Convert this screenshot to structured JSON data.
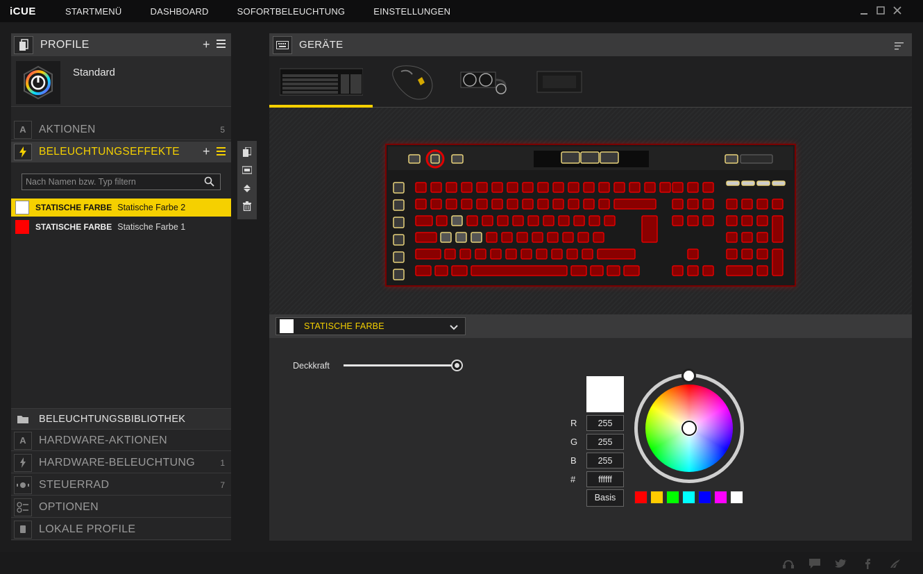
{
  "app": {
    "logo": "iCUE"
  },
  "nav": {
    "items": [
      {
        "label": "STARTMENÜ"
      },
      {
        "label": "DASHBOARD"
      },
      {
        "label": "SOFORTBELEUCHTUNG"
      },
      {
        "label": "EINSTELLUNGEN"
      }
    ]
  },
  "profiles": {
    "title": "PROFILE",
    "current": "Standard"
  },
  "sections": {
    "aktionen": {
      "label": "AKTIONEN",
      "count": "5"
    },
    "effects": {
      "label": "BELEUCHTUNGSEFFEKTE"
    },
    "library": {
      "label": "BELEUCHTUNGSBIBLIOTHEK"
    },
    "hw_actions": {
      "label": "HARDWARE-AKTIONEN"
    },
    "hw_lighting": {
      "label": "HARDWARE-BELEUCHTUNG",
      "count": "1"
    },
    "wheel": {
      "label": "STEUERRAD",
      "count": "7"
    },
    "options": {
      "label": "OPTIONEN"
    },
    "local": {
      "label": "LOKALE PROFILE"
    }
  },
  "filter": {
    "placeholder": "Nach Namen bzw. Typ filtern"
  },
  "effects_list": [
    {
      "type": "STATISCHE FARBE",
      "name": "Statische Farbe 2",
      "color": "#ffffff",
      "selected": true
    },
    {
      "type": "STATISCHE FARBE",
      "name": "Statische Farbe 1",
      "color": "#ff0000",
      "selected": false
    }
  ],
  "devices": {
    "title": "GERÄTE",
    "items": [
      {
        "icon": "keyboard-thumbnail",
        "active": true
      },
      {
        "icon": "mouse-thumbnail",
        "active": false
      },
      {
        "icon": "cooler-thumbnail",
        "active": false
      },
      {
        "icon": "controller-thumbnail",
        "active": false
      }
    ]
  },
  "effect_editor": {
    "selected_effect": "STATISCHE FARBE",
    "opacity_label": "Deckkraft",
    "opacity_value": 1.0,
    "r_label": "R",
    "r": "255",
    "g_label": "G",
    "g": "255",
    "b_label": "B",
    "b": "255",
    "hex_label": "#",
    "hex": "ffffff",
    "basis_label": "Basis",
    "basic_colors": [
      "#ff0000",
      "#ffcc00",
      "#00ff00",
      "#00ffff",
      "#0000ff",
      "#ff00ff",
      "#ffffff"
    ]
  },
  "colors": {
    "accent": "#f5d000",
    "key_lit": "#e00000",
    "panel": "#252526"
  },
  "footer": {
    "icons": [
      "support-icon",
      "chat-icon",
      "twitter-icon",
      "facebook-icon",
      "corsair-icon"
    ]
  }
}
